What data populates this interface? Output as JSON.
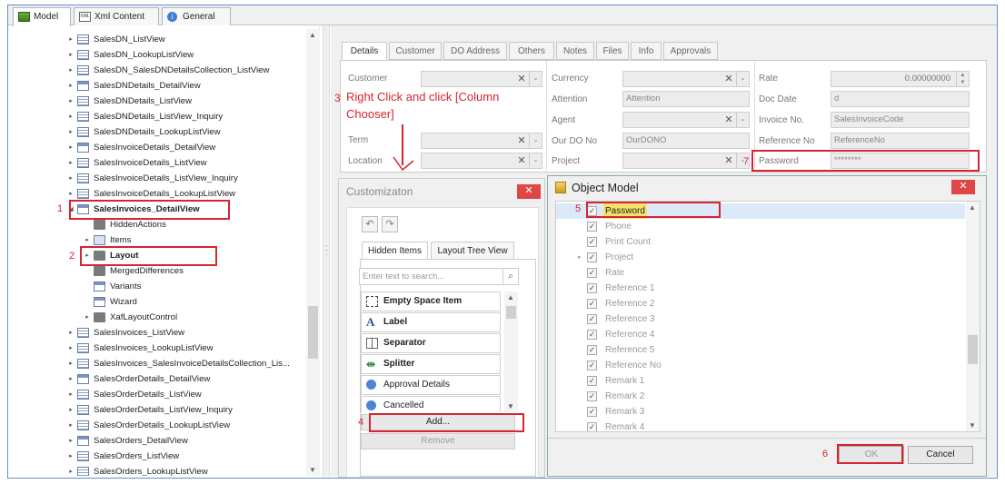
{
  "top_tabs": [
    {
      "label": "Model",
      "icon": "model-icon"
    },
    {
      "label": "Xml Content",
      "icon": "xml-icon"
    },
    {
      "label": "General",
      "icon": "info-icon"
    }
  ],
  "tree": {
    "items": [
      {
        "label": "SalesDN_ListView",
        "kind": "list"
      },
      {
        "label": "SalesDN_LookupListView",
        "kind": "list"
      },
      {
        "label": "SalesDN_SalesDNDetailsCollection_ListView",
        "kind": "list"
      },
      {
        "label": "SalesDNDetails_DetailView",
        "kind": "detail"
      },
      {
        "label": "SalesDNDetails_ListView",
        "kind": "list"
      },
      {
        "label": "SalesDNDetails_ListView_Inquiry",
        "kind": "list"
      },
      {
        "label": "SalesDNDetails_LookupListView",
        "kind": "list"
      },
      {
        "label": "SalesInvoiceDetails_DetailView",
        "kind": "detail"
      },
      {
        "label": "SalesInvoiceDetails_ListView",
        "kind": "list"
      },
      {
        "label": "SalesInvoiceDetails_ListView_Inquiry",
        "kind": "list"
      },
      {
        "label": "SalesInvoiceDetails_LookupListView",
        "kind": "list"
      },
      {
        "label": "SalesInvoices_DetailView",
        "kind": "detail"
      },
      {
        "label": "HiddenActions",
        "kind": "folder"
      },
      {
        "label": "Items",
        "kind": "items"
      },
      {
        "label": "Layout",
        "kind": "folder"
      },
      {
        "label": "MergedDifferences",
        "kind": "folder"
      },
      {
        "label": "Variants",
        "kind": "detail"
      },
      {
        "label": "Wizard",
        "kind": "detail"
      },
      {
        "label": "XafLayoutControl",
        "kind": "folder"
      },
      {
        "label": "SalesInvoices_ListView",
        "kind": "list"
      },
      {
        "label": "SalesInvoices_LookupListView",
        "kind": "list"
      },
      {
        "label": "SalesInvoices_SalesInvoiceDetailsCollection_Lis...",
        "kind": "list"
      },
      {
        "label": "SalesOrderDetails_DetailView",
        "kind": "detail"
      },
      {
        "label": "SalesOrderDetails_ListView",
        "kind": "list"
      },
      {
        "label": "SalesOrderDetails_ListView_Inquiry",
        "kind": "list"
      },
      {
        "label": "SalesOrderDetails_LookupListView",
        "kind": "list"
      },
      {
        "label": "SalesOrders_DetailView",
        "kind": "detail"
      },
      {
        "label": "SalesOrders_ListView",
        "kind": "list"
      },
      {
        "label": "SalesOrders_LookupListView",
        "kind": "list"
      }
    ]
  },
  "detail_tabs": [
    "Details",
    "Customer",
    "DO Address",
    "Others",
    "Notes",
    "Files",
    "Info",
    "Approvals"
  ],
  "form": {
    "customer_label": "Customer",
    "term_label": "Term",
    "location_label": "Location",
    "currency_label": "Currency",
    "attention_label": "Attention",
    "attention_value": "Attention",
    "agent_label": "Agent",
    "ourdo_label": "Our DO No",
    "ourdo_value": "OurDONO",
    "project_label": "Project",
    "rate_label": "Rate",
    "rate_value": "0.00000000",
    "docdate_label": "Doc Date",
    "docdate_value": "d",
    "invoice_label": "Invoice No.",
    "invoice_value": "SalesInvoiceCode",
    "reference_label": "Reference No",
    "reference_value": "ReferenceNo",
    "password_label": "Password",
    "password_value": "********"
  },
  "annotations": {
    "step1": "1",
    "step2": "2",
    "step3": "3",
    "step3_text": "Right Click and click [Column Chooser]",
    "step4": "4",
    "step5": "5",
    "step6": "6",
    "step7": "7"
  },
  "customization": {
    "title": "Customizaton",
    "close": "✕",
    "tab_hidden": "Hidden Items",
    "tab_layout": "Layout Tree View",
    "search_placeholder": "Enter text to search...",
    "items": [
      {
        "label": "Empty Space Item",
        "bold": true,
        "icon": "empty-space-icon"
      },
      {
        "label": "Label",
        "bold": true,
        "icon": "label-a-icon"
      },
      {
        "label": "Separator",
        "bold": true,
        "icon": "separator-icon"
      },
      {
        "label": "Splitter",
        "bold": true,
        "icon": "splitter-icon"
      },
      {
        "label": "Approval Details",
        "bold": false,
        "icon": "field-icon"
      },
      {
        "label": "Cancelled",
        "bold": false,
        "icon": "field-icon"
      }
    ],
    "add_label": "Add...",
    "remove_label": "Remove"
  },
  "object_model": {
    "title": "Object Model",
    "close": "✕",
    "rows": [
      {
        "label": "Password",
        "selected": true,
        "expandable": false
      },
      {
        "label": "Phone",
        "selected": false,
        "expandable": false
      },
      {
        "label": "Print Count",
        "selected": false,
        "expandable": false
      },
      {
        "label": "Project",
        "selected": false,
        "expandable": true
      },
      {
        "label": "Rate",
        "selected": false,
        "expandable": false
      },
      {
        "label": "Reference 1",
        "selected": false,
        "expandable": false
      },
      {
        "label": "Reference 2",
        "selected": false,
        "expandable": false
      },
      {
        "label": "Reference 3",
        "selected": false,
        "expandable": false
      },
      {
        "label": "Reference 4",
        "selected": false,
        "expandable": false
      },
      {
        "label": "Reference 5",
        "selected": false,
        "expandable": false
      },
      {
        "label": "Reference No",
        "selected": false,
        "expandable": false
      },
      {
        "label": "Remark 1",
        "selected": false,
        "expandable": false
      },
      {
        "label": "Remark 2",
        "selected": false,
        "expandable": false
      },
      {
        "label": "Remark 3",
        "selected": false,
        "expandable": false
      },
      {
        "label": "Remark 4",
        "selected": false,
        "expandable": false
      }
    ],
    "ok_label": "OK",
    "cancel_label": "Cancel"
  },
  "colors": {
    "annotation_red": "#d7242f",
    "selection_yellow": "#f3e36b"
  }
}
